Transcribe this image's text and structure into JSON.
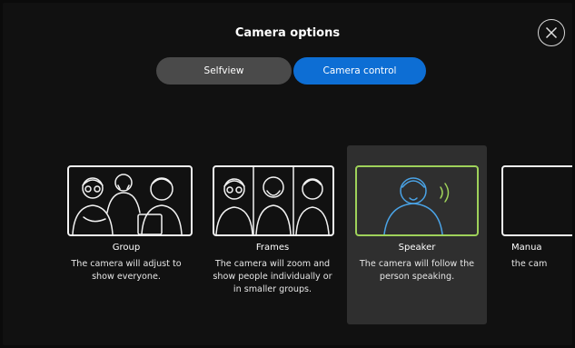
{
  "dialog": {
    "title": "Camera options",
    "close_icon": "close-icon"
  },
  "tabs": [
    {
      "label": "Selfview",
      "active": false
    },
    {
      "label": "Camera control",
      "active": true
    }
  ],
  "options": [
    {
      "id": "group",
      "label": "Group",
      "description": "The camera will adjust to show everyone.",
      "selected": false
    },
    {
      "id": "frames",
      "label": "Frames",
      "description": "The camera will zoom and show people individually or in smaller groups.",
      "selected": false
    },
    {
      "id": "speaker",
      "label": "Speaker",
      "description": "The camera will follow the person speaking.",
      "selected": true
    },
    {
      "id": "manual",
      "label": "Manua",
      "description": "the cam",
      "selected": false
    }
  ],
  "colors": {
    "background": "#111111",
    "accent": "#0d6ed4",
    "tab_inactive": "#4a4a4a",
    "selected_card": "#2f2f2f",
    "speaker_frame": "#9fd25a"
  }
}
